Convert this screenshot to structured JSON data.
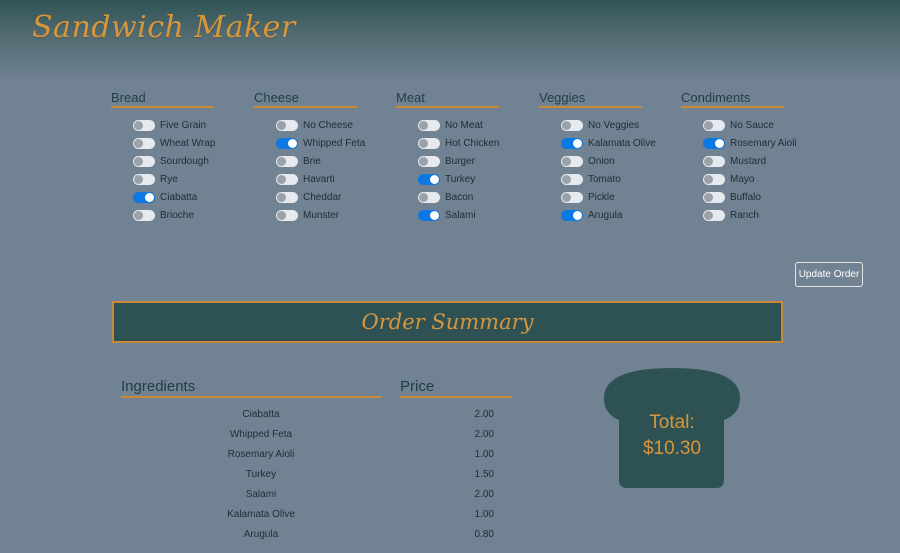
{
  "app": {
    "title": "Sandwich Maker"
  },
  "columns": [
    {
      "heading": "Bread",
      "options": [
        {
          "label": "Five Grain",
          "on": false
        },
        {
          "label": "Wheat Wrap",
          "on": false
        },
        {
          "label": "Sourdough",
          "on": false
        },
        {
          "label": "Rye",
          "on": false
        },
        {
          "label": "Ciabatta",
          "on": true
        },
        {
          "label": "Brioche",
          "on": false
        }
      ]
    },
    {
      "heading": "Cheese",
      "options": [
        {
          "label": "No Cheese",
          "on": false
        },
        {
          "label": "Whipped Feta",
          "on": true
        },
        {
          "label": "Brie",
          "on": false
        },
        {
          "label": "Havarti",
          "on": false
        },
        {
          "label": "Cheddar",
          "on": false
        },
        {
          "label": "Munster",
          "on": false
        }
      ]
    },
    {
      "heading": "Meat",
      "options": [
        {
          "label": "No Meat",
          "on": false
        },
        {
          "label": "Hot Chicken",
          "on": false
        },
        {
          "label": "Burger",
          "on": false
        },
        {
          "label": "Turkey",
          "on": true
        },
        {
          "label": "Bacon",
          "on": false
        },
        {
          "label": "Salami",
          "on": true
        }
      ]
    },
    {
      "heading": "Veggies",
      "options": [
        {
          "label": "No Veggies",
          "on": false
        },
        {
          "label": "Kalamata Olive",
          "on": true
        },
        {
          "label": "Onion",
          "on": false
        },
        {
          "label": "Tomato",
          "on": false
        },
        {
          "label": "Pickle",
          "on": false
        },
        {
          "label": "Arugula",
          "on": true
        }
      ]
    },
    {
      "heading": "Condiments",
      "options": [
        {
          "label": "No Sauce",
          "on": false
        },
        {
          "label": "Rosemary Aioli",
          "on": true
        },
        {
          "label": "Mustard",
          "on": false
        },
        {
          "label": "Mayo",
          "on": false
        },
        {
          "label": "Buffalo",
          "on": false
        },
        {
          "label": "Ranch",
          "on": false
        }
      ]
    }
  ],
  "update_button": "Update Order",
  "summary": {
    "banner": "Order Summary",
    "ingredients_header": "Ingredients",
    "price_header": "Price",
    "rows": [
      {
        "name": "Ciabatta",
        "price": "2.00"
      },
      {
        "name": "Whipped Feta",
        "price": "2.00"
      },
      {
        "name": "Rosemary Aioli",
        "price": "1.00"
      },
      {
        "name": "Turkey",
        "price": "1.50"
      },
      {
        "name": "Salami",
        "price": "2.00"
      },
      {
        "name": "Kalamata Olive",
        "price": "1.00"
      },
      {
        "name": "Arugula",
        "price": "0.80"
      }
    ],
    "total_label": "Total:",
    "total_value": "$10.30"
  },
  "colors": {
    "accent": "#d8963c",
    "panel": "#2e5254",
    "toggle_on": "#0b78e3",
    "background": "#718293"
  }
}
